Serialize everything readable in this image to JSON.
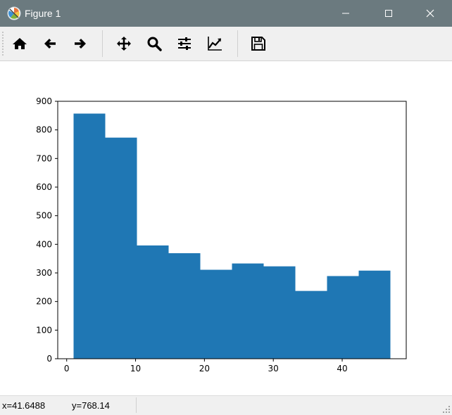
{
  "window": {
    "title": "Figure 1",
    "titlebar_color": "#6b7a7f"
  },
  "toolbar": {
    "buttons": [
      {
        "name": "home",
        "icon": "home-icon"
      },
      {
        "name": "back",
        "icon": "arrow-left-icon"
      },
      {
        "name": "forward",
        "icon": "arrow-right-icon"
      },
      {
        "name": "pan",
        "icon": "move-icon"
      },
      {
        "name": "zoom",
        "icon": "magnifier-icon"
      },
      {
        "name": "configure-subplots",
        "icon": "sliders-icon"
      },
      {
        "name": "edit-axis",
        "icon": "line-chart-icon"
      },
      {
        "name": "save",
        "icon": "floppy-disk-icon"
      }
    ]
  },
  "status": {
    "x_readout": "x=41.6488",
    "y_readout": "y=768.14"
  },
  "chart_data": {
    "type": "bar",
    "title": "",
    "xlabel": "",
    "ylabel": "",
    "bin_edges": [
      1,
      5.6,
      10.2,
      14.8,
      19.4,
      24,
      28.6,
      33.2,
      37.8,
      42.4,
      47
    ],
    "values": [
      857,
      773,
      396,
      369,
      311,
      333,
      323,
      237,
      289,
      308
    ],
    "xlim": [
      -1.3,
      49.3
    ],
    "ylim": [
      0,
      900
    ],
    "xticks": [
      0,
      10,
      20,
      30,
      40
    ],
    "yticks": [
      0,
      100,
      200,
      300,
      400,
      500,
      600,
      700,
      800,
      900
    ],
    "bar_color": "#1f77b4",
    "grid": false,
    "legend": "none"
  }
}
